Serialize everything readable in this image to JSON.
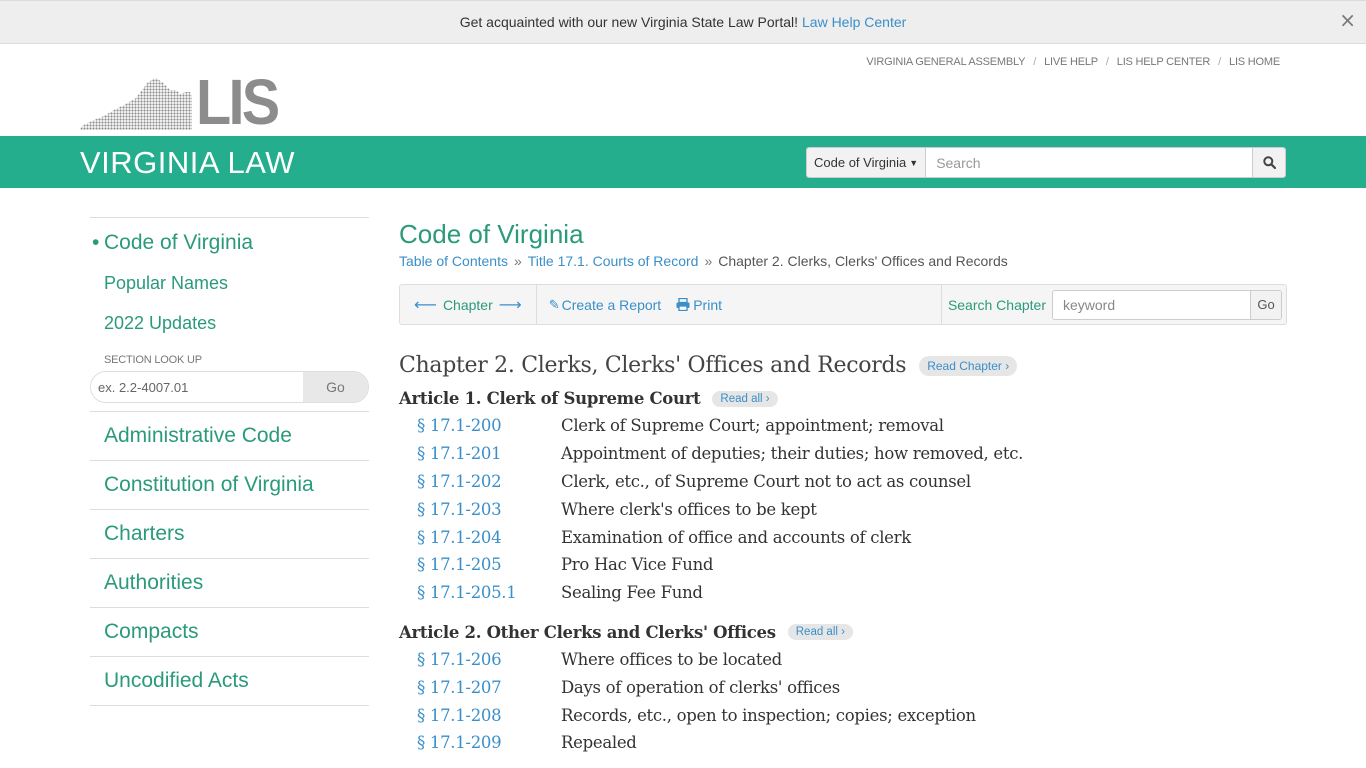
{
  "banner": {
    "text": "Get acquainted with our new Virginia State Law Portal!",
    "link": "Law Help Center",
    "close_icon": "×"
  },
  "top_links": [
    "VIRGINIA GENERAL ASSEMBLY",
    "LIVE HELP",
    "LIS HELP CENTER",
    "LIS HOME"
  ],
  "logo": {
    "text": "LIS"
  },
  "header": {
    "site_title": "VIRGINIA LAW",
    "search_scope": "Code of Virginia",
    "search_placeholder": "Search"
  },
  "sidebar": {
    "main_item": "Code of Virginia",
    "sub_items": [
      "Popular Names",
      "2022 Updates"
    ],
    "lookup_label": "SECTION LOOK UP",
    "lookup_placeholder": "ex. 2.2-4007.01",
    "lookup_go": "Go",
    "items": [
      "Administrative Code",
      "Constitution of Virginia",
      "Charters",
      "Authorities",
      "Compacts",
      "Uncodified Acts"
    ]
  },
  "main": {
    "title": "Code of Virginia",
    "breadcrumb": [
      {
        "label": "Table of Contents",
        "link": true
      },
      {
        "label": "Title 17.1. Courts of Record",
        "link": true
      },
      {
        "label": "Chapter 2. Clerks, Clerks' Offices and Records",
        "link": false
      }
    ],
    "breadcrumb_sep": "»",
    "toolbar": {
      "chapter_label": "Chapter",
      "create_report": "Create a Report",
      "print": "Print",
      "search_label": "Search Chapter",
      "search_placeholder": "keyword",
      "search_go": "Go"
    },
    "chapter": {
      "title": "Chapter 2. Clerks, Clerks' Offices and Records",
      "read_label": "Read Chapter ›"
    },
    "articles": [
      {
        "title": "Article 1. Clerk of Supreme Court",
        "read_label": "Read all ›",
        "sections": [
          {
            "num": "§ 17.1-200",
            "title": "Clerk of Supreme Court; appointment; removal"
          },
          {
            "num": "§ 17.1-201",
            "title": "Appointment of deputies; their duties; how removed, etc."
          },
          {
            "num": "§ 17.1-202",
            "title": "Clerk, etc., of Supreme Court not to act as counsel"
          },
          {
            "num": "§ 17.1-203",
            "title": "Where clerk's offices to be kept"
          },
          {
            "num": "§ 17.1-204",
            "title": "Examination of office and accounts of clerk"
          },
          {
            "num": "§ 17.1-205",
            "title": "Pro Hac Vice Fund"
          },
          {
            "num": "§ 17.1-205.1",
            "title": "Sealing Fee Fund"
          }
        ]
      },
      {
        "title": "Article 2. Other Clerks and Clerks' Offices",
        "read_label": "Read all ›",
        "sections": [
          {
            "num": "§ 17.1-206",
            "title": "Where offices to be located"
          },
          {
            "num": "§ 17.1-207",
            "title": "Days of operation of clerks' offices"
          },
          {
            "num": "§ 17.1-208",
            "title": "Records, etc., open to inspection; copies; exception"
          },
          {
            "num": "§ 17.1-209",
            "title": "Repealed"
          }
        ]
      }
    ]
  },
  "colors": {
    "brand_green": "#25ae8d",
    "link_green": "#2a9a7b",
    "link_blue": "#3a8fc9",
    "logo_gray": "#8c8c8c"
  }
}
